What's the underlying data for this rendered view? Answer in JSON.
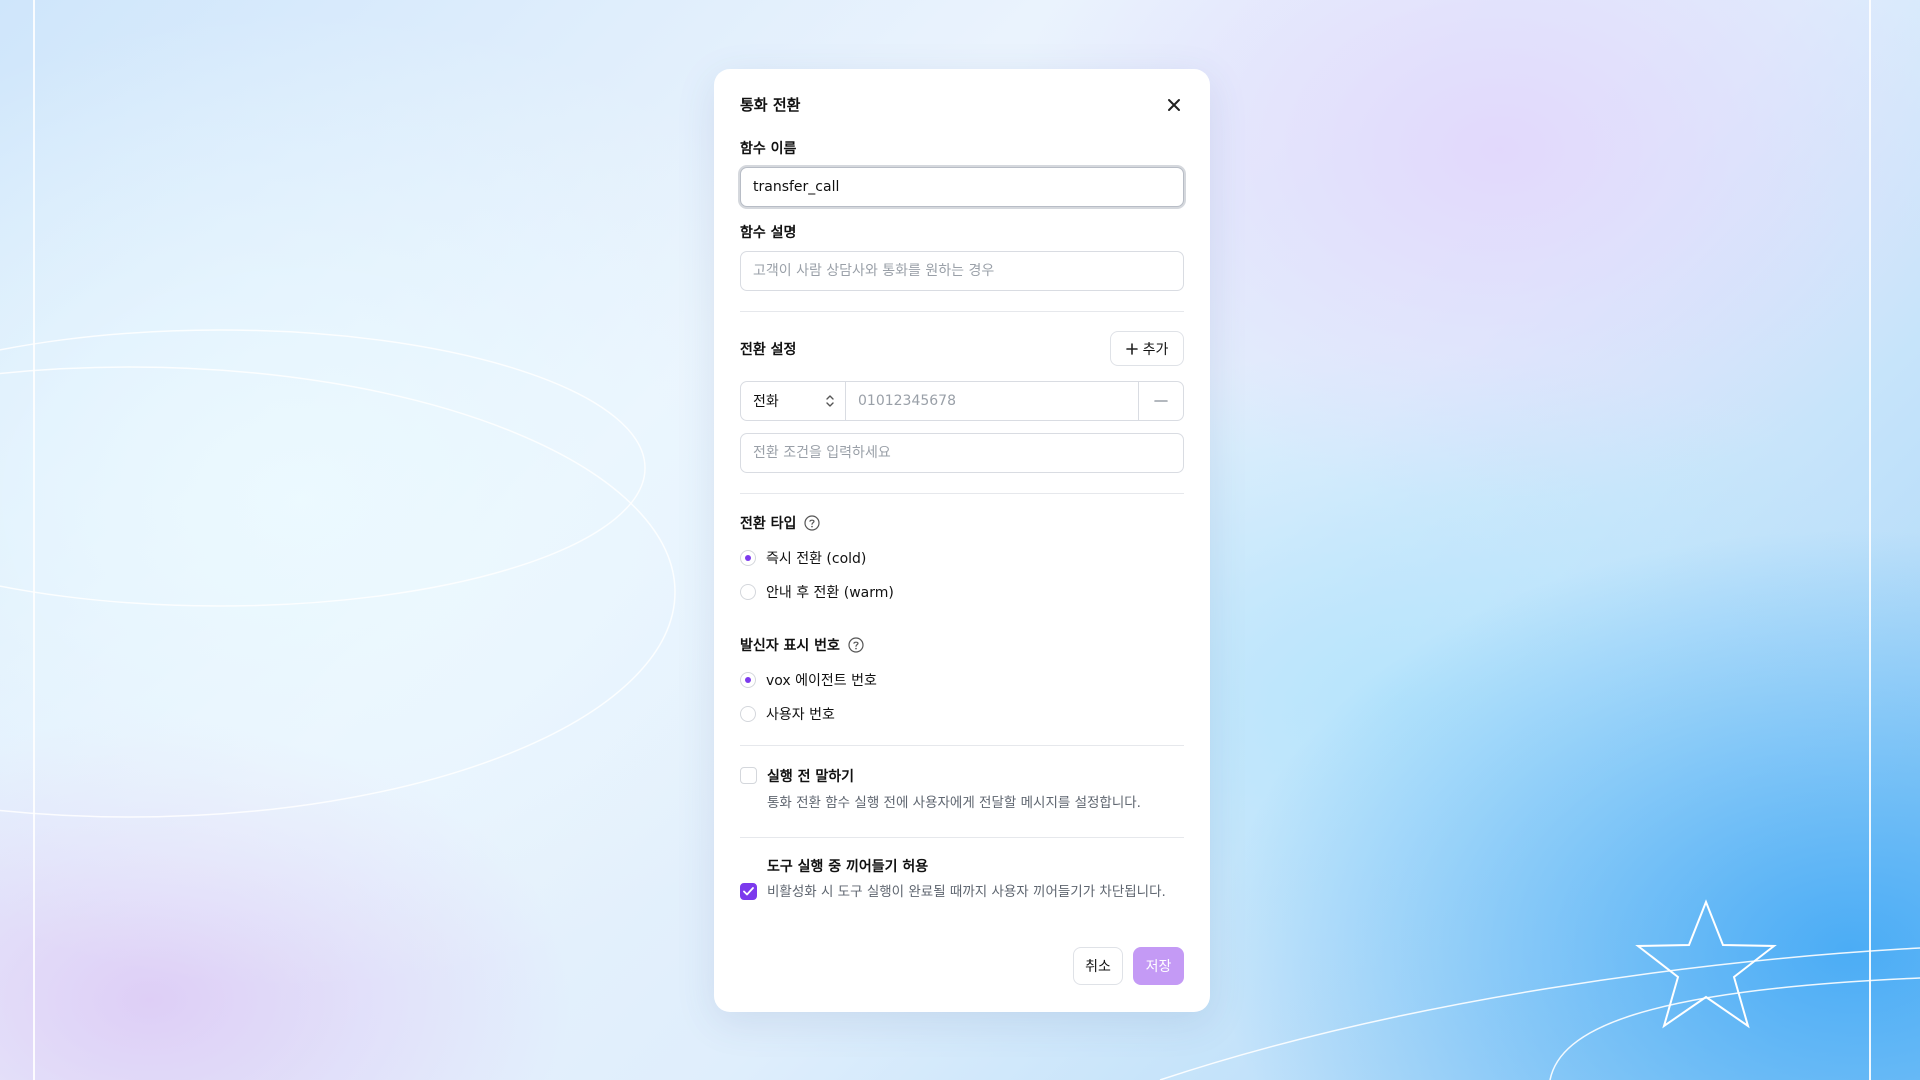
{
  "modal": {
    "title": "통화 전환",
    "function_name": {
      "label": "함수 이름",
      "value": "transfer_call"
    },
    "function_description": {
      "label": "함수 설명",
      "placeholder": "고객이 사람 상담사와 통화를 원하는 경우"
    },
    "transfer_settings": {
      "label": "전환 설정",
      "add_label": "추가",
      "destination_type": "전화",
      "phone_placeholder": "01012345678",
      "condition_placeholder": "전환 조건을 입력하세요"
    },
    "transfer_type": {
      "label": "전환 타입",
      "options": [
        {
          "label": "즉시 전환 (cold)",
          "selected": true
        },
        {
          "label": "안내 후 전환 (warm)",
          "selected": false
        }
      ]
    },
    "caller_id": {
      "label": "발신자 표시 번호",
      "options": [
        {
          "label": "vox 에이전트 번호",
          "selected": true
        },
        {
          "label": "사용자 번호",
          "selected": false
        }
      ]
    },
    "speak_before": {
      "checked": false,
      "title": "실행 전 말하기",
      "description": "통화 전환 함수 실행 전에 사용자에게 전달할 메시지를 설정합니다."
    },
    "allow_interrupt": {
      "checked": true,
      "title": "도구 실행 중 끼어들기 허용",
      "description": "비활성화 시 도구 실행이 완료될 때까지 사용자 끼어들기가 차단됩니다."
    },
    "cancel_label": "취소",
    "save_label": "저장"
  },
  "colors": {
    "accent": "#7c3aed",
    "save_disabled": "#c49af5"
  }
}
